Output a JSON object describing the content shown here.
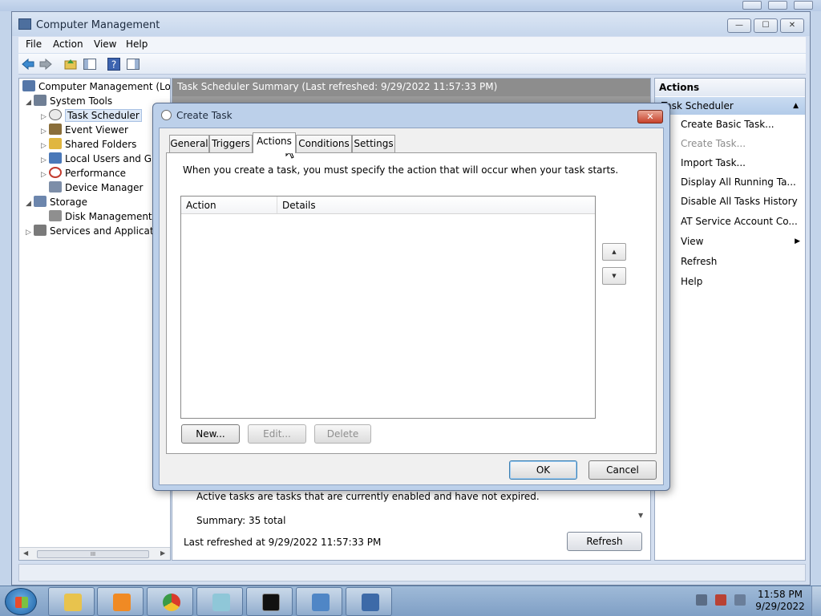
{
  "main_window": {
    "title": "Computer Management",
    "controls": {
      "minimize": "—",
      "maximize": "☐",
      "close": "✕"
    },
    "menu": [
      "File",
      "Action",
      "View",
      "Help"
    ]
  },
  "tree": {
    "items": [
      {
        "label": "Computer Management (Local",
        "twisty": "",
        "icon_color": "#5577a8"
      },
      {
        "label": "System Tools",
        "twisty": "◢",
        "icon_color": "#6f7f95"
      },
      {
        "label": "Task Scheduler",
        "twisty": "▷",
        "icon_color": "#d9d9d9"
      },
      {
        "label": "Event Viewer",
        "twisty": "▷",
        "icon_color": "#8a6e3a"
      },
      {
        "label": "Shared Folders",
        "twisty": "▷",
        "icon_color": "#e0b640"
      },
      {
        "label": "Local Users and Gro",
        "twisty": "▷",
        "icon_color": "#4a78b8"
      },
      {
        "label": "Performance",
        "twisty": "▷",
        "icon_color": "#c23b2e"
      },
      {
        "label": "Device Manager",
        "twisty": "",
        "icon_color": "#7d8ea8"
      },
      {
        "label": "Storage",
        "twisty": "◢",
        "icon_color": "#6c86ad"
      },
      {
        "label": "Disk Management",
        "twisty": "",
        "icon_color": "#8f8f8f"
      },
      {
        "label": "Services and Application",
        "twisty": "▷",
        "icon_color": "#7a7a7a"
      }
    ],
    "scroll_left": "◀",
    "scroll_right": "▶",
    "scroll_grip": "III"
  },
  "center": {
    "header": "Task Scheduler Summary (Last refreshed: 9/29/2022 11:57:33 PM)",
    "active_tasks_text": "Active tasks are tasks that are currently enabled and have not expired.",
    "summary": "Summary: 35 total",
    "last_refreshed": "Last refreshed at 9/29/2022 11:57:33 PM",
    "refresh_button": "Refresh",
    "scroll_down": "▼"
  },
  "actions_pane": {
    "header": "Actions",
    "section": "Task Scheduler",
    "section_caret": "▲",
    "items": [
      {
        "label": "Create Basic Task...",
        "enabled": true
      },
      {
        "label": "Create Task...",
        "enabled": false
      },
      {
        "label": "Import Task...",
        "enabled": true
      },
      {
        "label": "Display All Running Ta...",
        "enabled": true
      },
      {
        "label": "Disable All Tasks History",
        "enabled": true
      },
      {
        "label": "AT Service Account Co...",
        "enabled": true
      },
      {
        "label": "View",
        "enabled": true,
        "submenu": true
      },
      {
        "label": "Refresh",
        "enabled": true
      },
      {
        "label": "Help",
        "enabled": true
      }
    ],
    "submenu_arrow": "▶"
  },
  "dialog": {
    "title": "Create Task",
    "close": "✕",
    "tabs": [
      "General",
      "Triggers",
      "Actions",
      "Conditions",
      "Settings"
    ],
    "active_tab": "Actions",
    "description": "When you create a task, you must specify the action that will occur when your task starts.",
    "columns": [
      "Action",
      "Details"
    ],
    "move_up": "▲",
    "move_down": "▼",
    "buttons": {
      "new": "New...",
      "edit": "Edit...",
      "delete": "Delete"
    },
    "ok": "OK",
    "cancel": "Cancel"
  },
  "taskbar": {
    "apps": [
      {
        "name": "explorer",
        "color": "#e8c34d"
      },
      {
        "name": "media-player",
        "color": "#f08a24"
      },
      {
        "name": "chrome",
        "color": "#d93b2b"
      },
      {
        "name": "notepad",
        "color": "#8fc7d8"
      },
      {
        "name": "command-prompt",
        "color": "#111111"
      },
      {
        "name": "remote-desktop",
        "color": "#4f86c6"
      },
      {
        "name": "computer-management",
        "color": "#3d6aa8"
      }
    ],
    "time": "11:58 PM",
    "date": "9/29/2022"
  }
}
